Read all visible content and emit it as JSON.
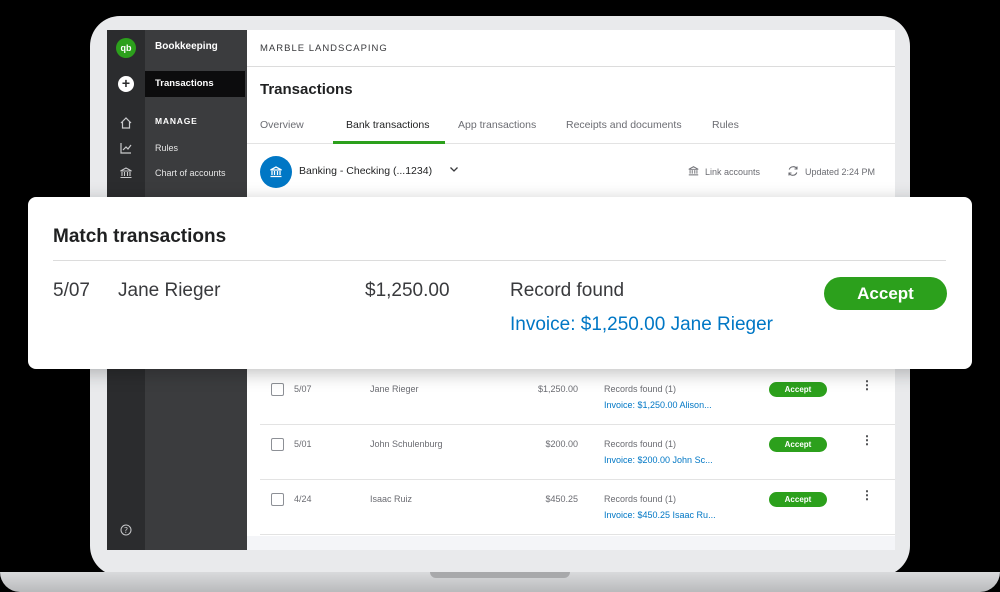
{
  "app": {
    "logo_text": "qb",
    "company_name": "MARBLE LANDSCAPING",
    "page_title": "Transactions"
  },
  "sidebar": {
    "title": "Bookkeeping",
    "active_item": "Transactions",
    "section_label": "MANAGE",
    "items": [
      {
        "label": "Rules",
        "icon": "chart-icon"
      },
      {
        "label": "Chart of accounts",
        "icon": "bank-icon"
      }
    ]
  },
  "rail_icons": [
    "logo",
    "plus-icon",
    "home-icon",
    "chart-icon",
    "bank-icon",
    "help-icon"
  ],
  "tabs": [
    {
      "label": "Overview",
      "active": false
    },
    {
      "label": "Bank transactions",
      "active": true
    },
    {
      "label": "App transactions",
      "active": false
    },
    {
      "label": "Receipts and documents",
      "active": false
    },
    {
      "label": "Rules",
      "active": false
    }
  ],
  "account": {
    "selected": "Banking - Checking (...1234)",
    "link_accounts_label": "Link accounts",
    "updated_label": "Updated 2:24 PM"
  },
  "match_card": {
    "title": "Match transactions",
    "date": "5/07",
    "name": "Jane Rieger",
    "amount": "$1,250.00",
    "record_status": "Record found",
    "match_link": "Invoice: $1,250.00 Jane Rieger",
    "accept_label": "Accept"
  },
  "transactions": [
    {
      "date": "5/07",
      "name": "Jane Rieger",
      "amount": "$1,250.00",
      "records": "Records found (1)",
      "match": "Invoice: $1,250.00 Alison...",
      "accept_label": "Accept"
    },
    {
      "date": "5/01",
      "name": "John Schulenburg",
      "amount": "$200.00",
      "records": "Records found (1)",
      "match": "Invoice: $200.00 John Sc...",
      "accept_label": "Accept"
    },
    {
      "date": "4/24",
      "name": "Isaac Ruiz",
      "amount": "$450.25",
      "records": "Records found (1)",
      "match": "Invoice: $450.25 Isaac Ru...",
      "accept_label": "Accept"
    }
  ],
  "colors": {
    "brand_green": "#2ca01c",
    "link_blue": "#0077c5",
    "nav_dark": "#2b2c2e"
  }
}
